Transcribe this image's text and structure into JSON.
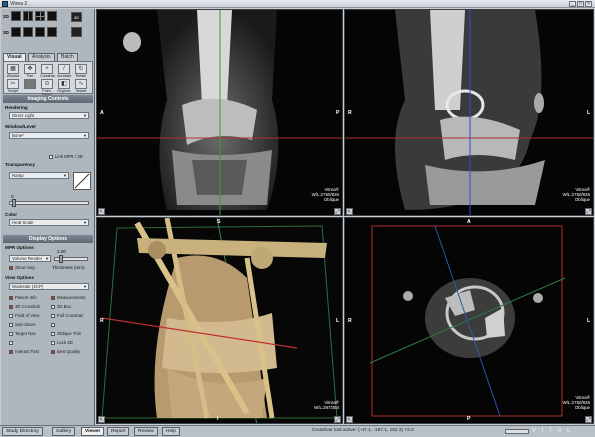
{
  "window": {
    "title": "Vitrea 2"
  },
  "layout_selector": {
    "label_2d": "2D",
    "label_3d": "3D",
    "label_4d": "4D"
  },
  "left_tabs": [
    {
      "label": "Visual"
    },
    {
      "label": "Analysis"
    },
    {
      "label": "Batch"
    }
  ],
  "tools": [
    {
      "label": "Window",
      "icon": "window-icon"
    },
    {
      "label": "Pan",
      "icon": "pan-icon"
    },
    {
      "label": "Crosshair",
      "icon": "crosshair-icon"
    },
    {
      "label": "Annotate",
      "icon": "annotate-icon"
    },
    {
      "label": "Rotate",
      "icon": "rotate-icon"
    },
    {
      "label": "Sculpt",
      "icon": "sculpt-icon"
    },
    {
      "label": "",
      "icon": "gray-icon"
    },
    {
      "label": "Point-Select",
      "icon": "point-select-icon"
    },
    {
      "label": "Regions",
      "icon": "regions-icon"
    },
    {
      "label": "Vessel",
      "icon": "vessel-icon"
    }
  ],
  "imaging_controls": {
    "title": "Imaging Controls",
    "rendering_label": "Rendering",
    "rendering_value": "Direct Light",
    "window_level_label": "Window/Level",
    "window_level_value": "Bone*",
    "link_mpr_label": "Link MPR / 3D",
    "transparency_label": "Transparency",
    "transparency_value": "Ramp",
    "slider_zero": "0",
    "color_label": "Color",
    "color_value": "Heat Scale"
  },
  "display_options": {
    "title": "Display Options",
    "mpr_options_label": "MPR Options",
    "volume_render_value": "Volume Render",
    "thickness_value": "2.00",
    "show_seg_label": "Show Seg",
    "thickness_label": "Thickness (mm)",
    "view_options_label": "View Options",
    "view_options_value": "Moderate (4CP)",
    "checks": [
      {
        "label": "Patient Info",
        "on": true
      },
      {
        "label": "Measurements",
        "on": true
      },
      {
        "label": "3D Crosshair",
        "on": true
      },
      {
        "label": "3D Box",
        "on": false
      },
      {
        "label": "Field of View",
        "on": false
      },
      {
        "label": "Full Crosshair",
        "on": false
      },
      {
        "label": "Sub-Slices",
        "on": false
      },
      {
        "label": "",
        "on": false
      },
      {
        "label": "Target Nav",
        "on": false
      },
      {
        "label": "Oblique Trim",
        "on": false
      },
      {
        "label": "",
        "on": false
      },
      {
        "label": "Lock 3D",
        "on": false
      },
      {
        "label": "Interact Fast",
        "on": true
      },
      {
        "label": "Best Quality",
        "on": true
      }
    ]
  },
  "viewports": {
    "tl": {
      "left": "A",
      "right": "P",
      "vitrea": "Vitrea®",
      "wl": "W/L:2750/826",
      "orient": "Oblique"
    },
    "tr": {
      "left": "R",
      "right": "L",
      "vitrea": "Vitrea®",
      "wl": "W/L:2750/826",
      "orient": "Oblique"
    },
    "bl": {
      "top": "S",
      "left": "R",
      "right": "L",
      "bottom": "I",
      "vitrea": "Vitrea®",
      "wl": "W/L:297/384"
    },
    "br": {
      "top": "A",
      "left": "R",
      "right": "L",
      "bottom": "P",
      "vitrea": "Vitrea®",
      "wl": "W/L:2750/826",
      "orient": "Oblique"
    }
  },
  "bottom_tabs": [
    {
      "label": "Study Directory"
    },
    {
      "label": "Gallery"
    },
    {
      "label": "Viewer"
    },
    {
      "label": "Report"
    },
    {
      "label": "Review"
    },
    {
      "label": "Help"
    }
  ],
  "status": {
    "text": "Crosshair tool active: (-47.1, -157.1, 152.3) 74.0",
    "brand": "V I T A L"
  },
  "colors": {
    "accent": "#b23a2a",
    "header": "#5d6873",
    "panel": "#aeb6be"
  }
}
